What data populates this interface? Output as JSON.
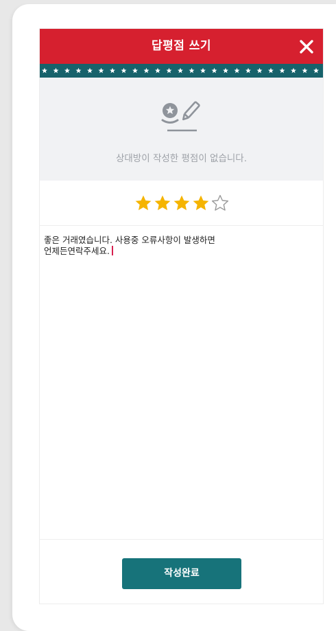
{
  "modal": {
    "title": "답평점 쓰기",
    "close_icon": "close-icon"
  },
  "strip": {
    "icon": "star-icon",
    "color": "#17626b"
  },
  "info": {
    "icon": "review-edit-icon",
    "message": "상대방이 작성한 평점이 없습니다."
  },
  "rating": {
    "value": 4,
    "max": 5,
    "filled_color": "#f5b400",
    "empty_color": "#9a9a9a"
  },
  "review": {
    "text": "좋은 거래였습니다. 사용중 오류사항이 발생하면\n언제든연락주세요."
  },
  "submit": {
    "label": "작성완료"
  },
  "colors": {
    "header": "#d6202f",
    "button": "#17737a",
    "info_bg": "#f1f2f4"
  }
}
